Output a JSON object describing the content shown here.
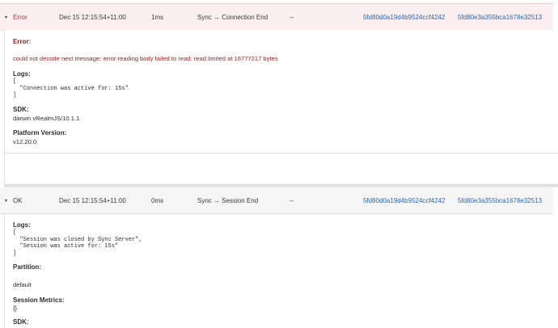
{
  "error_entry": {
    "caret": "▾",
    "status": "Error",
    "timestamp": "Dec 15 12:15:54+11:00",
    "duration": "1ms",
    "type": "Sync → Connection End",
    "extra": "--",
    "id1": "5fd80d0a19d4b9524ccf4242",
    "id2": "5fd80e3a355bca1678e32513",
    "error_label": "Error:",
    "error_message": "could not decode next message: error reading body failed to read: read limited at 16777217 bytes",
    "logs_label": "Logs:",
    "logs": "[\n  \"Connection was active for: 15s\"\n]",
    "sdk_label": "SDK:",
    "sdk": "darwin vRealmJS/10.1.1",
    "platform_label": "Platform Version:",
    "platform": "v12.20.0"
  },
  "ok_entry": {
    "caret": "▾",
    "status": "OK",
    "timestamp": "Dec 15 12:15:54+11:00",
    "duration": "0ms",
    "type": "Sync → Session End",
    "extra": "--",
    "id1": "5fd80d0a19d4b9524ccf4242",
    "id2": "5fd80e3a355bca1678e32513",
    "logs_label": "Logs:",
    "logs": "[\n  \"Session was closed by Sync Server\",\n  \"Session was active for: 15s\"\n]",
    "partition_label": "Partition:",
    "partition": "default",
    "metrics_label": "Session Metrics:",
    "metrics": "{}",
    "sdk_label": "SDK:"
  }
}
